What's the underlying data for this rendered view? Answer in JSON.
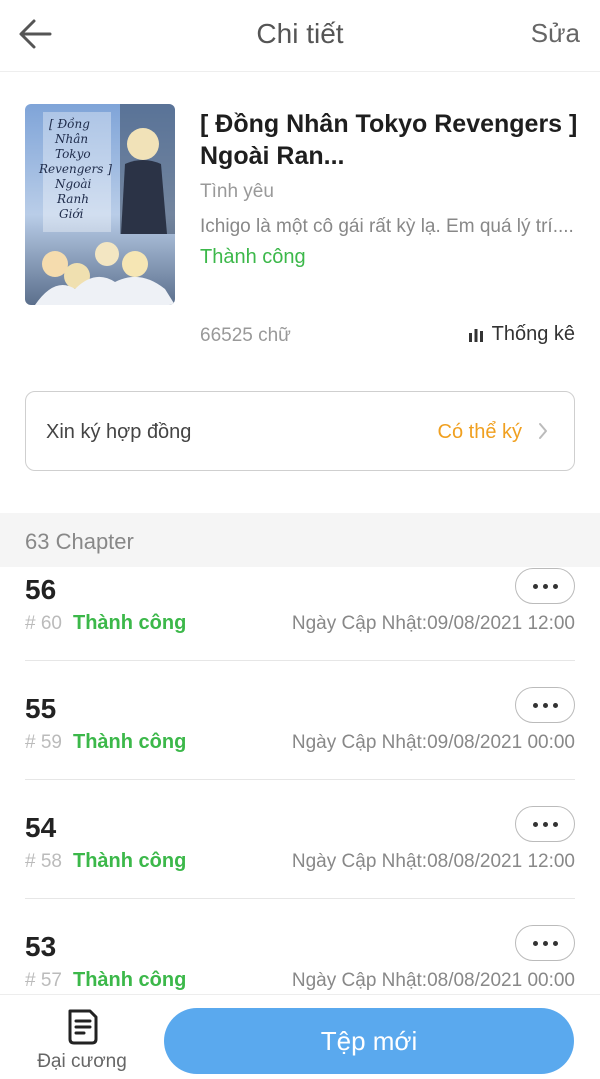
{
  "header": {
    "back_icon": "arrow-left-icon",
    "title": "Chi tiết",
    "edit_label": "Sửa"
  },
  "book": {
    "cover_text": [
      "[ Đồng",
      "Nhân",
      "Tokyo",
      "Revengers ]",
      "Ngoài",
      "Ranh",
      "Giới"
    ],
    "title": "[ Đồng Nhân Tokyo Revengers ] Ngoài Ran...",
    "genre": "Tình yêu",
    "description": "Ichigo là một cô gái rất kỳ lạ. Em quá lý trí....",
    "status": "Thành công",
    "word_count": "66525 chữ",
    "stats_label": "Thống kê",
    "stats_icon": "bar-chart-icon"
  },
  "contract": {
    "label": "Xin ký hợp đồng",
    "status": "Có thể ký",
    "chevron_icon": "chevron-right-icon"
  },
  "chapters": {
    "count_label": "63 Chapter",
    "items": [
      {
        "number": "56",
        "index": "# 60",
        "status": "Thành công",
        "date_label": "Ngày Cập Nhật:",
        "date": "09/08/2021 12:00"
      },
      {
        "number": "55",
        "index": "# 59",
        "status": "Thành công",
        "date_label": "Ngày Cập Nhật:",
        "date": "09/08/2021 00:00"
      },
      {
        "number": "54",
        "index": "# 58",
        "status": "Thành công",
        "date_label": "Ngày Cập Nhật:",
        "date": "08/08/2021 12:00"
      },
      {
        "number": "53",
        "index": "# 57",
        "status": "Thành công",
        "date_label": "Ngày Cập Nhật:",
        "date": "08/08/2021 00:00"
      }
    ]
  },
  "bottom": {
    "outline_label": "Đại cương",
    "outline_icon": "document-icon",
    "new_file_label": "Tệp mới"
  },
  "colors": {
    "success": "#3cb84a",
    "warning": "#f0a020",
    "primary": "#5aa9ee"
  }
}
